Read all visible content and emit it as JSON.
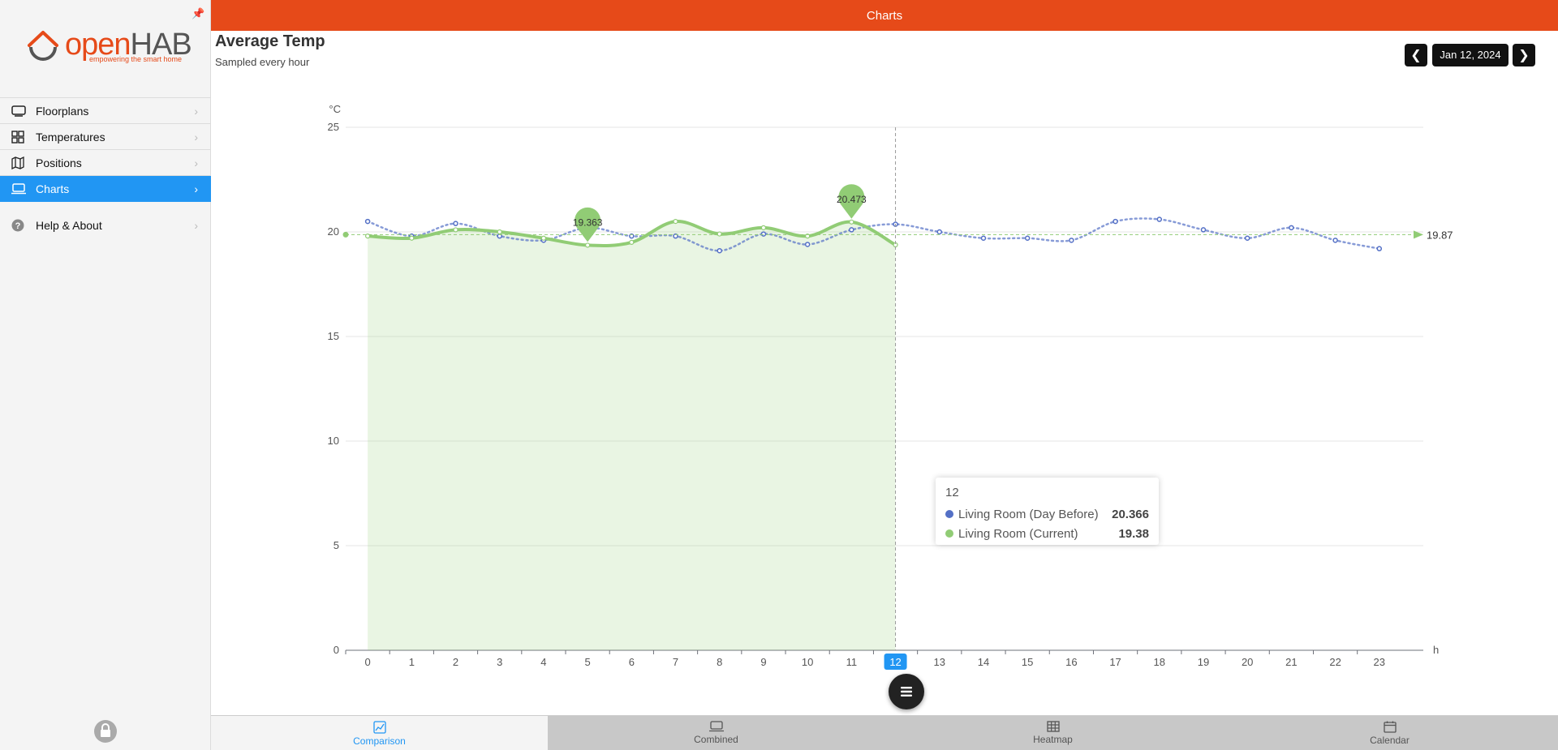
{
  "header": {
    "title": "Charts",
    "page_title": "Average Temp",
    "page_subtitle": "Sampled every hour",
    "date": "Jan 12, 2024",
    "prev_icon": "chevron-left-icon",
    "next_icon": "chevron-right-icon"
  },
  "brand": {
    "logo_open": "open",
    "logo_hab": "HAB",
    "tagline": "empowering the smart home",
    "accent": "#e64a19",
    "active_blue": "#2196f3"
  },
  "sidebar": {
    "items": [
      {
        "label": "Floorplans",
        "icon": "floorplan-icon",
        "active": false
      },
      {
        "label": "Temperatures",
        "icon": "grid-icon",
        "active": false
      },
      {
        "label": "Positions",
        "icon": "map-icon",
        "active": false
      },
      {
        "label": "Charts",
        "icon": "laptop-icon",
        "active": true
      }
    ],
    "help_label": "Help & About"
  },
  "chart_data": {
    "type": "line",
    "title": "",
    "ylabel": "°C",
    "xlabel": "h",
    "ylim": [
      0,
      25
    ],
    "yticks": [
      0,
      5,
      10,
      15,
      20,
      25
    ],
    "categories": [
      "0",
      "1",
      "2",
      "3",
      "4",
      "5",
      "6",
      "7",
      "8",
      "9",
      "10",
      "11",
      "12",
      "13",
      "14",
      "15",
      "16",
      "17",
      "18",
      "19",
      "20",
      "21",
      "22",
      "23"
    ],
    "series": [
      {
        "name": "Living Room (Day Before)",
        "color": "#5470c6",
        "style": "dotted",
        "values": [
          20.5,
          19.8,
          20.4,
          19.8,
          19.6,
          20.2,
          19.8,
          19.8,
          19.1,
          19.9,
          19.4,
          20.1,
          20.366,
          20.0,
          19.7,
          19.7,
          19.6,
          20.5,
          20.6,
          20.1,
          19.7,
          20.2,
          19.6,
          19.2
        ]
      },
      {
        "name": "Living Room (Current)",
        "color": "#91cc75",
        "style": "solid-area",
        "values": [
          19.8,
          19.7,
          20.1,
          20.0,
          19.7,
          19.363,
          19.5,
          20.5,
          19.9,
          20.2,
          19.8,
          20.473,
          19.38
        ]
      }
    ],
    "markers": {
      "min": {
        "label": "19.363",
        "index": 5
      },
      "max": {
        "label": "20.473",
        "index": 11
      }
    },
    "average": {
      "label": "19.87",
      "value": 19.87
    },
    "highlight_x": "12",
    "grid": true,
    "legend": "none"
  },
  "tooltip": {
    "title": "12",
    "rows": [
      {
        "name": "Living Room (Day Before)",
        "value": "20.366",
        "color": "#5470c6"
      },
      {
        "name": "Living Room (Current)",
        "value": "19.38",
        "color": "#91cc75"
      }
    ]
  },
  "tabs": [
    {
      "label": "Comparison",
      "icon": "chart-icon",
      "active": true
    },
    {
      "label": "Combined",
      "icon": "laptop-icon",
      "active": false
    },
    {
      "label": "Heatmap",
      "icon": "table-icon",
      "active": false
    },
    {
      "label": "Calendar",
      "icon": "calendar-icon",
      "active": false
    }
  ]
}
